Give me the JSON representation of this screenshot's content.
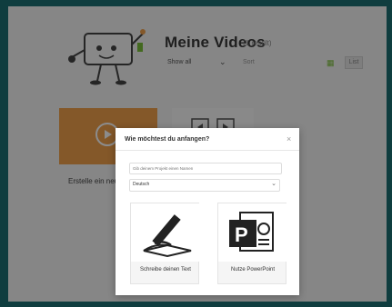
{
  "header": {
    "title": "Meine Videos",
    "count": "(1 result)",
    "filter_label": "Show all",
    "sort_label": "Sort",
    "list_view_label": "List"
  },
  "tiles": {
    "create_label": "Erstelle ein neues"
  },
  "modal": {
    "title": "Wie möchtest du anfangen?",
    "project_placeholder": "Gib deinem Projekt einen Namen",
    "language_value": "Deutsch",
    "options": [
      {
        "label": "Schreibe deinen Text",
        "icon": "pen-paper-icon"
      },
      {
        "label": "Nutze PowerPoint",
        "icon": "powerpoint-icon"
      }
    ]
  },
  "colors": {
    "frame": "#0f3d3f",
    "accent_orange": "#f0a04b",
    "accent_green": "#7bbf3a"
  }
}
